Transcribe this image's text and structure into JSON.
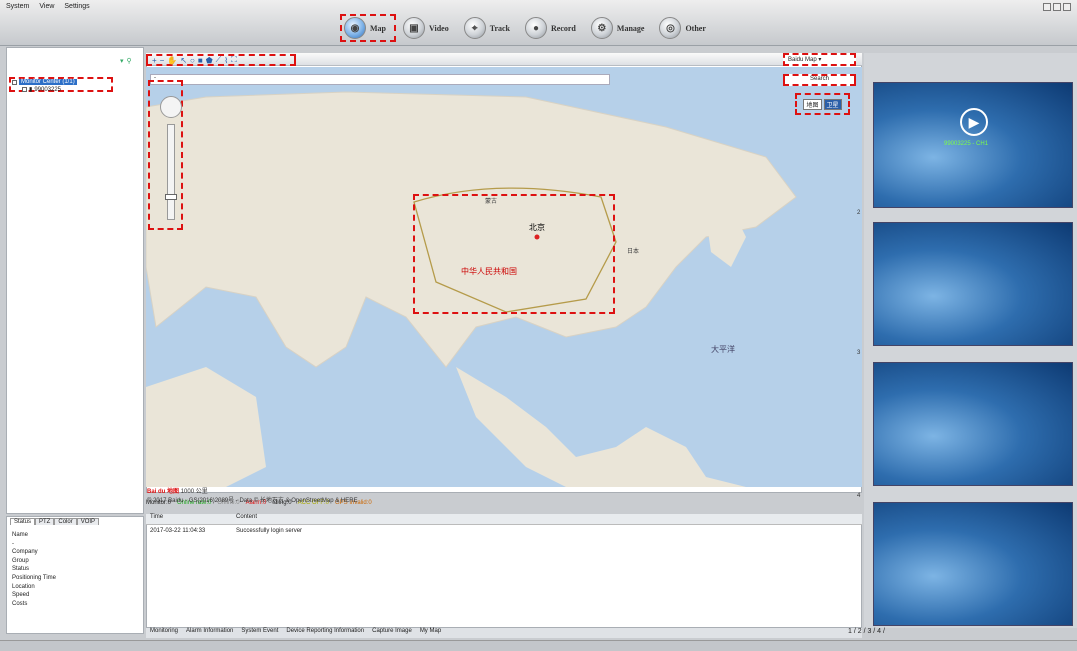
{
  "menu": [
    "System",
    "View",
    "Settings"
  ],
  "nav": [
    {
      "label": "Map",
      "icon": "globe-icon"
    },
    {
      "label": "Video",
      "icon": "camera-icon"
    },
    {
      "label": "Track",
      "icon": "track-icon"
    },
    {
      "label": "Record",
      "icon": "record-icon"
    },
    {
      "label": "Manage",
      "icon": "manage-icon"
    },
    {
      "label": "Other",
      "icon": "other-icon"
    }
  ],
  "tree": {
    "root": "Monitor Center (1/1)",
    "device": "99003225"
  },
  "map": {
    "base_map": "Baidu Map",
    "search": "Search",
    "address": "-",
    "sat_toggle": [
      "地图",
      "卫星"
    ],
    "labels": [
      "北京",
      "中华人民共和国",
      "大平洋",
      "蒙古",
      "日本"
    ],
    "copyright": "© 2017 Baidu - GS(2016)2089号 - Data © 长地万方 & OpenStreetMap & HERE",
    "scale": "1000 公里",
    "logo": "Bai du 地图"
  },
  "status_counts": [
    "Monitor:0",
    "Online rate:0",
    "Offline:0",
    "Alarm:0",
    "Idling:0",
    "ACC OFF:0",
    "GPS Invalid:0"
  ],
  "left_tabs": [
    "Status",
    "PTZ",
    "Color",
    "VOIP"
  ],
  "info_rows": [
    "Name",
    "-",
    "Company",
    "Group",
    "Status",
    "Positioning Time",
    "Location",
    "Speed",
    "Costs"
  ],
  "log": {
    "headers": [
      "Time",
      "Content"
    ],
    "rows": [
      [
        "2017-03-22 11:04:33",
        "Successfully login server"
      ]
    ]
  },
  "bottom_tabs": [
    "Monitoring",
    "Alarm Information",
    "System Event",
    "Device Reporting Information",
    "Capture Image",
    "My Map"
  ],
  "video": {
    "overlay": "99003225 - CH1",
    "slots": [
      "1",
      "2",
      "3",
      "4"
    ]
  },
  "pager": "1 / 2 / 3 / 4 /"
}
